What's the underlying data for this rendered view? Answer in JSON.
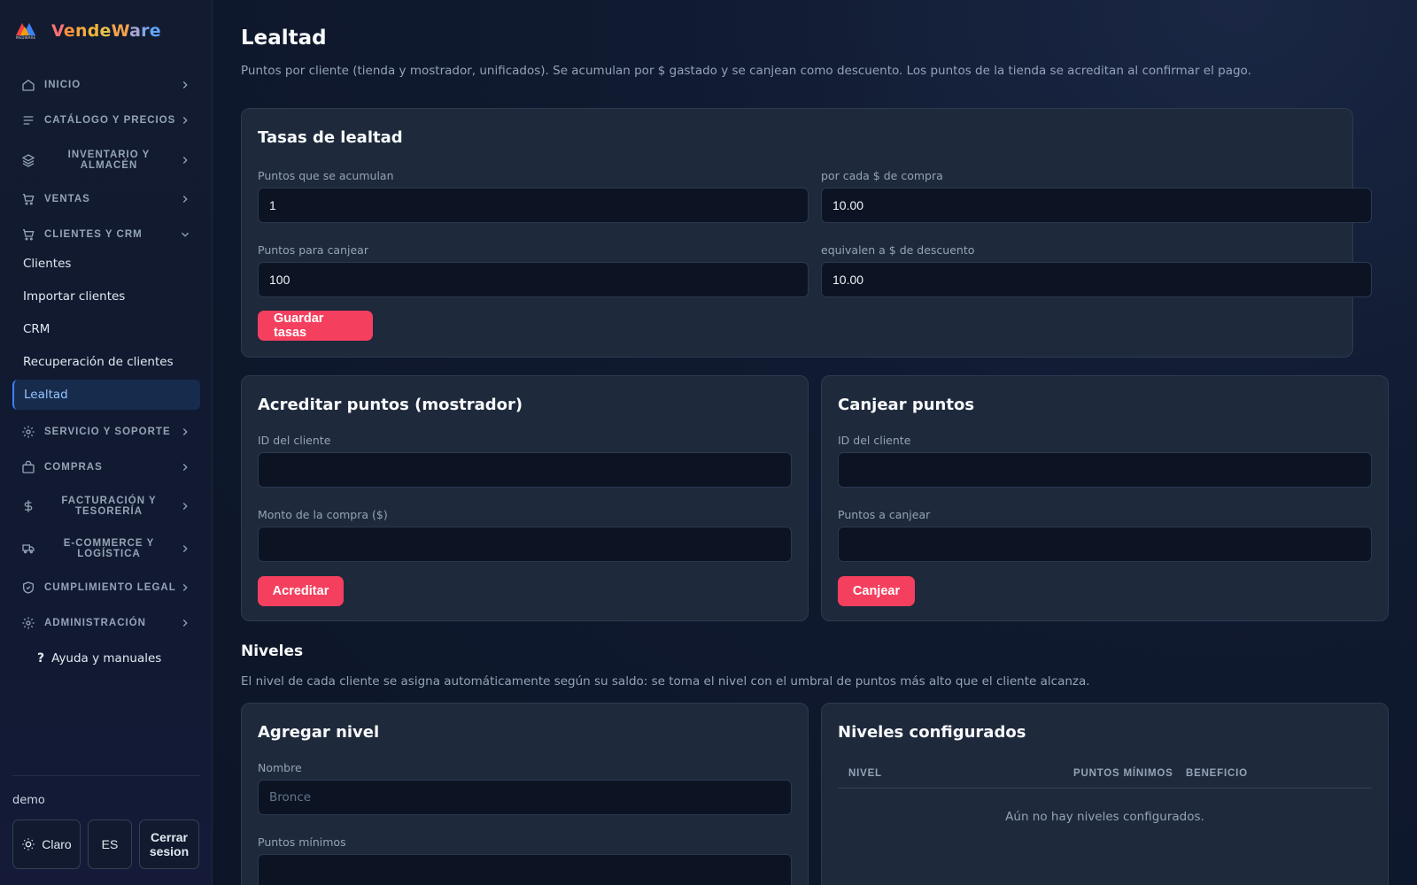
{
  "brand": {
    "logo_text": "MEDWARE",
    "name_letters": [
      "V",
      "e",
      "n",
      "d",
      "e",
      "W",
      "a",
      "r",
      "e"
    ]
  },
  "sidebar": {
    "sections": [
      {
        "label": "INICIO",
        "icon": "home-icon",
        "expanded": false
      },
      {
        "label": "CATÁLOGO Y PRECIOS",
        "icon": "list-icon",
        "expanded": false
      },
      {
        "label_line1": "INVENTARIO Y",
        "label_line2": "ALMACÉN",
        "icon": "layers-icon",
        "expanded": false
      },
      {
        "label": "VENTAS",
        "icon": "cart-icon",
        "expanded": false
      },
      {
        "label": "CLIENTES Y CRM",
        "icon": "cart-icon",
        "expanded": true
      },
      {
        "label": "SERVICIO Y SOPORTE",
        "icon": "gear-icon",
        "expanded": false
      },
      {
        "label": "COMPRAS",
        "icon": "bag-icon",
        "expanded": false
      },
      {
        "label_line1": "FACTURACIÓN Y",
        "label_line2": "TESORERÍA",
        "icon": "dollar-icon",
        "expanded": false
      },
      {
        "label_line1": "E-COMMERCE Y",
        "label_line2": "LOGÍSTICA",
        "icon": "truck-icon",
        "expanded": false
      },
      {
        "label": "CUMPLIMIENTO LEGAL",
        "icon": "shield-icon",
        "expanded": false
      },
      {
        "label": "ADMINISTRACIÓN",
        "icon": "gear-icon",
        "expanded": false
      }
    ],
    "crm_items": [
      "Clientes",
      "Importar clientes",
      "CRM",
      "Recuperación de clientes",
      "Lealtad"
    ],
    "active_item": "Lealtad",
    "help_label": "Ayuda y manuales",
    "user": "demo",
    "theme_label": "Claro",
    "lang_label": "ES",
    "logout_line1": "Cerrar",
    "logout_line2": "sesion"
  },
  "page": {
    "title": "Lealtad",
    "description": "Puntos por cliente (tienda y mostrador, unificados). Se acumulan por $ gastado y se canjean como descuento. Los puntos de la tienda se acreditan al confirmar el pago."
  },
  "rates": {
    "title": "Tasas de lealtad",
    "earn_points_label": "Puntos que se acumulan",
    "earn_points_value": "1",
    "per_amount_label": "por cada $ de compra",
    "per_amount_value": "10.00",
    "redeem_points_label": "Puntos para canjear",
    "redeem_points_value": "100",
    "discount_label": "equivalen a $ de descuento",
    "discount_value": "10.00",
    "save_label": "Guardar tasas"
  },
  "credit": {
    "title": "Acreditar puntos (mostrador)",
    "customer_id_label": "ID del cliente",
    "customer_id_value": "",
    "amount_label": "Monto de la compra ($)",
    "amount_value": "",
    "button_label": "Acreditar"
  },
  "redeem": {
    "title": "Canjear puntos",
    "customer_id_label": "ID del cliente",
    "customer_id_value": "",
    "points_label": "Puntos a canjear",
    "points_value": "",
    "button_label": "Canjear"
  },
  "levels": {
    "title": "Niveles",
    "description": "El nivel de cada cliente se asigna automáticamente según su saldo: se toma el nivel con el umbral de puntos más alto que el cliente alcanza.",
    "add": {
      "title": "Agregar nivel",
      "name_label": "Nombre",
      "name_placeholder": "Bronce",
      "min_points_label": "Puntos mínimos",
      "min_points_value": ""
    },
    "configured": {
      "title": "Niveles configurados",
      "columns": [
        "NIVEL",
        "PUNTOS MÍNIMOS",
        "BENEFICIO"
      ],
      "rows": [],
      "empty_message": "Aún no hay niveles configurados."
    }
  },
  "colors": {
    "accent": "#f43f5e",
    "active_bg": "#172b4d",
    "active_text": "#93c5fd",
    "card_bg": "#1e293b"
  }
}
